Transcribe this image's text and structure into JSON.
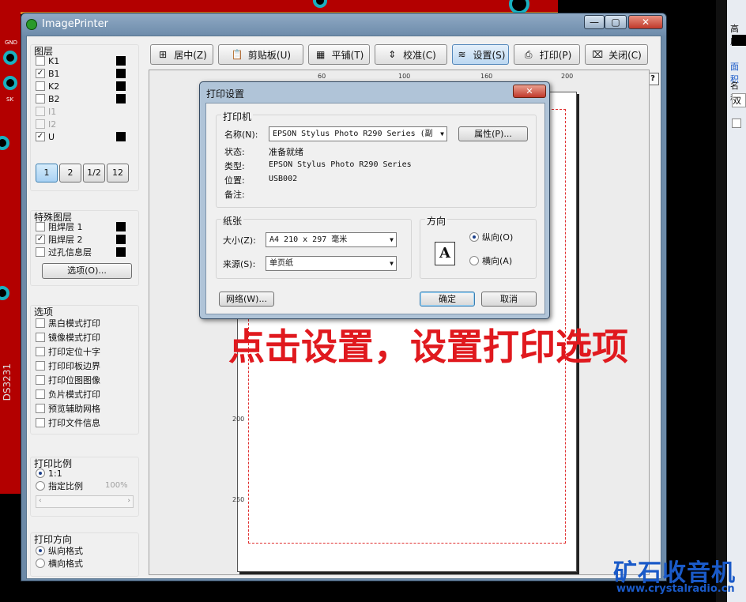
{
  "window": {
    "title": "ImagePrinter"
  },
  "titlebar_buttons": {
    "minimize": "—",
    "maximize": "▢",
    "close": "✕"
  },
  "layers": {
    "title": "图层",
    "items": [
      {
        "label": "K1",
        "checked": false,
        "enabled": true,
        "swatch": true
      },
      {
        "label": "B1",
        "checked": true,
        "enabled": true,
        "swatch": true
      },
      {
        "label": "K2",
        "checked": false,
        "enabled": true,
        "swatch": true
      },
      {
        "label": "B2",
        "checked": false,
        "enabled": true,
        "swatch": true
      },
      {
        "label": "I1",
        "checked": false,
        "enabled": false,
        "swatch": false
      },
      {
        "label": "I2",
        "checked": false,
        "enabled": false,
        "swatch": false
      },
      {
        "label": "U",
        "checked": true,
        "enabled": true,
        "swatch": true
      }
    ],
    "view_buttons": [
      "1",
      "2",
      "1/2",
      "12"
    ]
  },
  "special_layers": {
    "title": "特殊图层",
    "items": [
      {
        "label": "阻焊层 1",
        "checked": false
      },
      {
        "label": "阻焊层 2",
        "checked": true
      },
      {
        "label": "过孔信息层",
        "checked": false
      }
    ],
    "options_button": "选项(O)..."
  },
  "options": {
    "title": "选项",
    "items": [
      "黑白模式打印",
      "镜像模式打印",
      "打印定位十字",
      "打印印板边界",
      "打印位图图像",
      "负片模式打印",
      "预览辅助网格",
      "打印文件信息"
    ]
  },
  "scale": {
    "title": "打印比例",
    "opt1": "1:1",
    "opt2": "指定比例",
    "percent": "100%"
  },
  "orientation_left": {
    "title": "打印方向",
    "opt1": "纵向格式",
    "opt2": "横向格式"
  },
  "toolbar": [
    {
      "icon": "center-icon",
      "glyph": "⊞",
      "label": "居中(Z)"
    },
    {
      "icon": "clipboard-icon",
      "glyph": "📋",
      "label": "剪贴板(U)"
    },
    {
      "icon": "tile-icon",
      "glyph": "▦",
      "label": "平铺(T)"
    },
    {
      "icon": "calibrate-icon",
      "glyph": "⇕",
      "label": "校准(C)"
    },
    {
      "icon": "settings-icon",
      "glyph": "≋",
      "label": "设置(S)"
    },
    {
      "icon": "printer-icon",
      "glyph": "⎙",
      "label": "打印(P)"
    },
    {
      "icon": "close-doc-icon",
      "glyph": "⌧",
      "label": "关闭(C)"
    }
  ],
  "help": "?",
  "ruler": {
    "top": [
      "60",
      "100",
      "160",
      "200"
    ],
    "left": [
      "200",
      "250"
    ]
  },
  "annotation": "点击设置，设置打印选项",
  "dialog": {
    "title": "打印设置",
    "close": "✕",
    "printer_section": "打印机",
    "name_label": "名称(N):",
    "name_value": "EPSON Stylus Photo R290 Series (副",
    "properties_button": "属性(P)...",
    "status_label": "状态:",
    "status_value": "准备就绪",
    "type_label": "类型:",
    "type_value": "EPSON Stylus Photo R290 Series",
    "where_label": "位置:",
    "where_value": "USB002",
    "comment_label": "备注:",
    "paper_section": "纸张",
    "size_label": "大小(Z):",
    "size_value": "A4 210 x 297 毫米",
    "source_label": "来源(S):",
    "source_value": "单页纸",
    "orient_section": "方向",
    "portrait": "纵向(O)",
    "landscape": "横向(A)",
    "portrait_glyph": "A",
    "network_button": "网络(W)...",
    "ok_button": "确定",
    "cancel_button": "取消"
  },
  "pcb_label": "DS3231",
  "pcb_pins": {
    "top": "GND",
    "bottom": "SK"
  },
  "watermark": {
    "logo": "矿石收音机",
    "url": "www.crystalradio.cn"
  },
  "right_panel": {
    "a": "高度",
    "b": "面积",
    "c": "名称",
    "d": "双面"
  }
}
